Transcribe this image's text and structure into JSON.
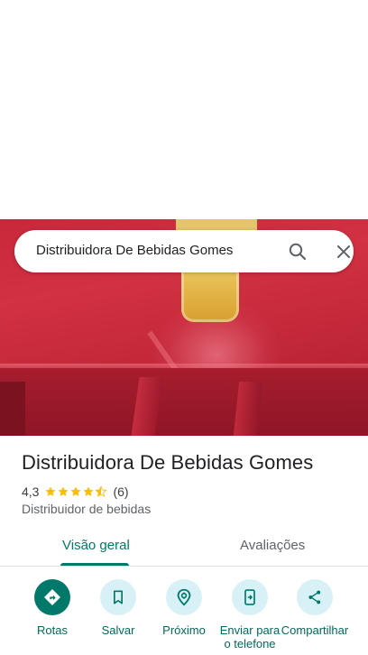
{
  "search": {
    "query": "Distribuidora De Bebidas Gomes",
    "search_icon": "search-icon",
    "close_icon": "close-icon"
  },
  "place": {
    "name": "Distribuidora De Bebidas Gomes",
    "rating": "4,3",
    "rating_value": 4.3,
    "review_count": "(6)",
    "category": "Distribuidor de bebidas"
  },
  "tabs": [
    {
      "label": "Visão geral",
      "active": true
    },
    {
      "label": "Avaliações",
      "active": false
    }
  ],
  "actions": [
    {
      "label": "Rotas",
      "icon": "directions-icon"
    },
    {
      "label": "Salvar",
      "icon": "bookmark-icon"
    },
    {
      "label": "Próximo",
      "icon": "nearby-icon"
    },
    {
      "label": "Enviar para o telefone",
      "icon": "send-to-phone-icon"
    },
    {
      "label": "Compartilhar",
      "icon": "share-icon"
    }
  ],
  "colors": {
    "accent": "#00796b",
    "star": "#fbbc04",
    "action_circle": "#d8f1f6"
  }
}
